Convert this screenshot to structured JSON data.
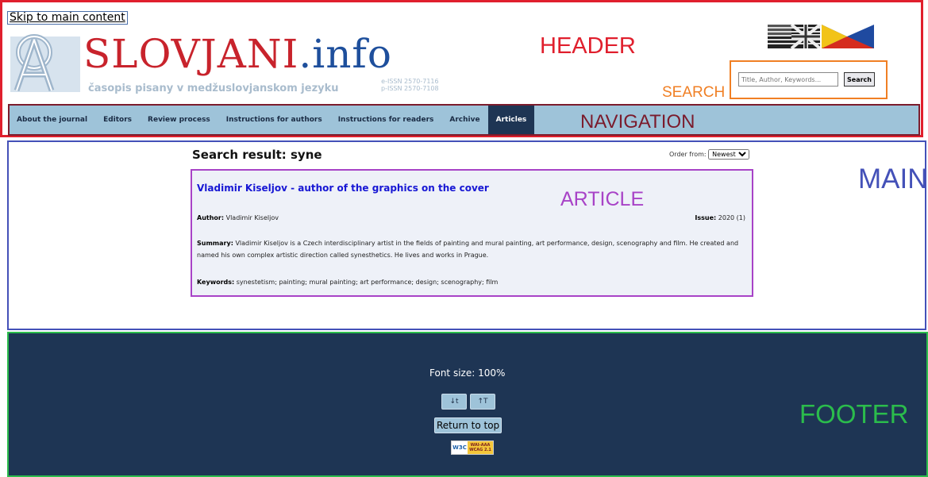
{
  "skip_link": "Skip to main content",
  "site": {
    "title_main": "SLOVJANI",
    "title_tld": ".info",
    "subtitle": "časopis pisany v medžuslovjanskom jezyku",
    "issn_e": "e-ISSN 2570-7116",
    "issn_p": "p-ISSN 2570-7108"
  },
  "regions": {
    "header": "HEADER",
    "search": "SEARCH",
    "navigation": "NAVIGATION",
    "main": "MAIN",
    "article": "ARTICLE",
    "footer": "FOOTER"
  },
  "flags": [
    "english-flag-icon",
    "interslavic-flag-icon"
  ],
  "search": {
    "placeholder": "Title, Author, Keywords...",
    "button": "Search"
  },
  "nav": {
    "items": [
      {
        "label": "About the journal",
        "active": false
      },
      {
        "label": "Editors",
        "active": false
      },
      {
        "label": "Review process",
        "active": false
      },
      {
        "label": "Instructions for authors",
        "active": false
      },
      {
        "label": "Instructions for readers",
        "active": false
      },
      {
        "label": "Archive",
        "active": false
      },
      {
        "label": "Articles",
        "active": true
      }
    ]
  },
  "results": {
    "heading": "Search result: syne",
    "order_label": "Order from:",
    "order_selected": "Newest"
  },
  "article": {
    "title": "Vladimir Kiseljov - author of the graphics on the cover",
    "author_label": "Author:",
    "author": "Vladimir Kiseljov",
    "issue_label": "Issue:",
    "issue": "2020 (1)",
    "summary_label": "Summary:",
    "summary": "Vladimir Kiseljov is a Czech interdisciplinary artist in the fields of painting and mural painting, art performance, design, scenography and film. He created and named his own complex artistic direction called synesthetics. He lives and works in Prague.",
    "keywords_label": "Keywords:",
    "keywords": "synestetism; painting; mural painting; art performance; design; scenography; film"
  },
  "footer": {
    "font_size": "Font size: 100%",
    "decrease_label": "↓t",
    "increase_label": "↑T",
    "return_top": "Return to top",
    "badge_w3c": "W3C",
    "badge_wai": "WAI-AAA",
    "badge_wcag": "WCAG 2.1"
  },
  "colors": {
    "header_border": "#e01f2d",
    "search_border": "#f07f24",
    "nav_border": "#7b1b2c",
    "nav_bg": "#9ec3d9",
    "nav_active_bg": "#1e3554",
    "main_border": "#4451b8",
    "article_border": "#a843c7",
    "footer_border": "#2bbc4c",
    "footer_bg": "#1e3554",
    "title_red": "#c8232c",
    "title_blue": "#1e4f9c"
  }
}
